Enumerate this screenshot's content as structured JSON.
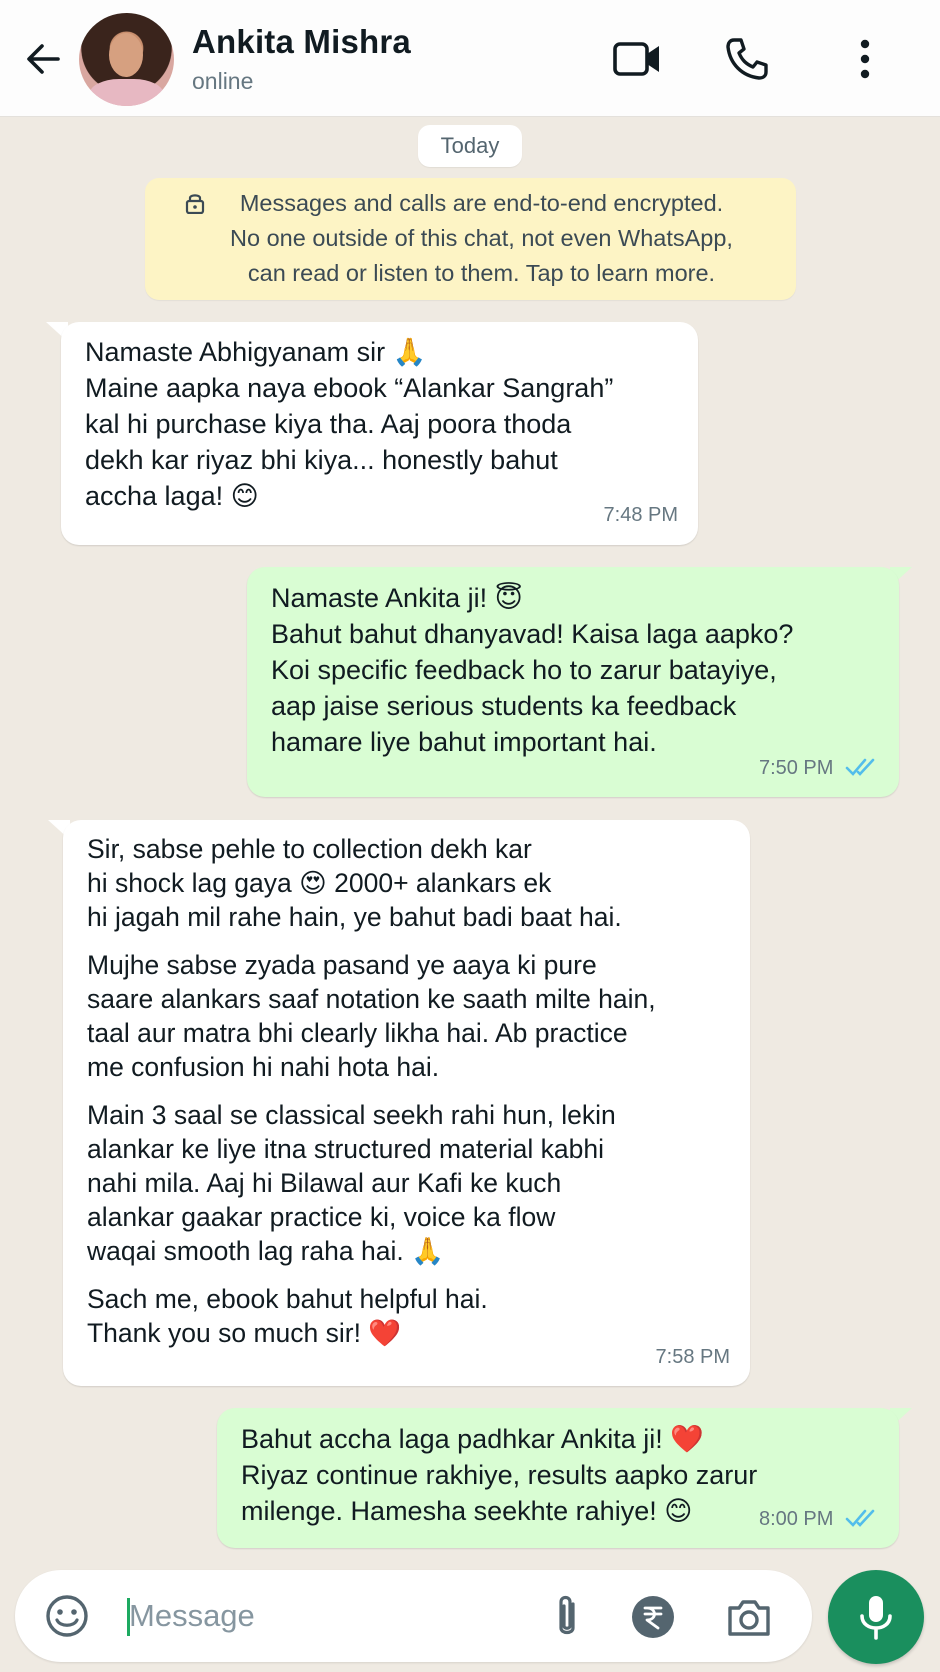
{
  "header": {
    "contact_name": "Ankita Mishra",
    "status": "online"
  },
  "chat": {
    "date_label": "Today",
    "encryption_notice": "Messages and calls are end-to-end encrypted.\nNo one outside of this chat, not even WhatsApp,\ncan read or listen to them. Tap to learn more.",
    "messages": [
      {
        "direction": "incoming",
        "text": "Namaste Abhigyanam sir 🙏\nMaine aapka naya ebook “Alankar Sangrah”\nkal hi purchase kiya tha. Aaj poora thoda\ndekh kar riyaz bhi kiya... honestly bahut\naccha laga! 😊",
        "time": "7:48 PM"
      },
      {
        "direction": "outgoing",
        "text": "Namaste Ankita ji! 😇\nBahut bahut dhanyavad! Kaisa laga aapko?\nKoi specific feedback ho to zarur batayiye,\naap jaise serious students ka feedback\nhamare liye bahut important hai.",
        "time": "7:50 PM",
        "read": true
      },
      {
        "direction": "incoming",
        "paragraphs": [
          "Sir, sabse pehle to collection dekh kar\nhi shock lag gaya 😍 2000+ alankars ek\nhi jagah mil rahe hain, ye bahut badi baat hai.",
          "Mujhe sabse zyada pasand ye aaya ki pure\nsaare alankars saaf notation ke saath milte hain,\ntaal aur matra bhi clearly likha hai. Ab practice\nme confusion hi nahi hota hai.",
          "Main 3 saal se classical seekh rahi hun, lekin\nalankar ke liye itna structured material kabhi\nnahi mila. Aaj hi Bilawal aur Kafi ke kuch\nalankar gaakar practice ki, voice ka flow\nwaqai smooth lag raha hai. 🙏",
          "Sach me, ebook bahut helpful hai.\nThank you so much sir! ❤️"
        ],
        "time": "7:58 PM"
      },
      {
        "direction": "outgoing",
        "text": "Bahut accha laga padhkar Ankita ji! ❤️\nRiyaz continue rakhiye, results aapko zarur\nmilenge. Hamesha seekhte rahiye! 😊",
        "time": "8:00 PM",
        "read": true
      }
    ]
  },
  "composer": {
    "placeholder": "Message"
  },
  "colors": {
    "outgoing_bubble": "#d9fdd3",
    "incoming_bubble": "#ffffff",
    "encryption_bg": "#fdf4c5",
    "accent_green": "#1a8f5e",
    "read_ticks": "#53bdeb"
  },
  "icons": [
    "back-arrow-icon",
    "video-call-icon",
    "voice-call-icon",
    "more-options-icon",
    "lock-icon",
    "double-check-icon",
    "emoji-icon",
    "attach-icon",
    "rupee-payment-icon",
    "camera-icon",
    "mic-icon"
  ]
}
